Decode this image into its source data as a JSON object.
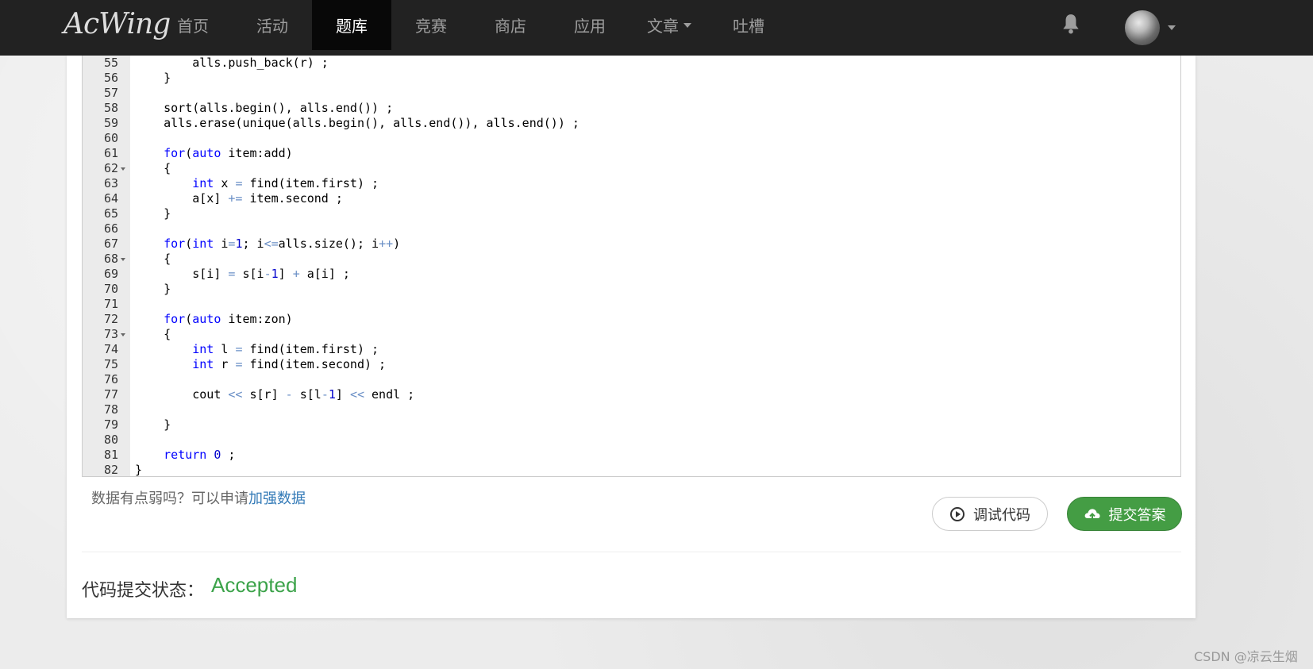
{
  "navbar": {
    "logo": "AcWing",
    "items": [
      {
        "label": "首页"
      },
      {
        "label": "活动"
      },
      {
        "label": "题库",
        "active": true
      },
      {
        "label": "竞赛"
      },
      {
        "label": "商店"
      },
      {
        "label": "应用"
      },
      {
        "label": "文章",
        "dropdown": true
      },
      {
        "label": "吐槽"
      }
    ],
    "bell_icon": "bell-icon",
    "avatar": "user-avatar"
  },
  "editor": {
    "lines": [
      {
        "n": "55",
        "fold": false,
        "code": "        alls.push_back(r) ;"
      },
      {
        "n": "56",
        "fold": false,
        "code": "    }"
      },
      {
        "n": "57",
        "fold": false,
        "code": ""
      },
      {
        "n": "58",
        "fold": false,
        "code": "    sort(alls.begin(), alls.end()) ;"
      },
      {
        "n": "59",
        "fold": false,
        "code": "    alls.erase(unique(alls.begin(), alls.end()), alls.end()) ;"
      },
      {
        "n": "60",
        "fold": false,
        "code": ""
      },
      {
        "n": "61",
        "fold": false,
        "code": "    for(auto item:add)"
      },
      {
        "n": "62",
        "fold": true,
        "code": "    {"
      },
      {
        "n": "63",
        "fold": false,
        "code": "        int x = find(item.first) ;"
      },
      {
        "n": "64",
        "fold": false,
        "code": "        a[x] += item.second ;"
      },
      {
        "n": "65",
        "fold": false,
        "code": "    }"
      },
      {
        "n": "66",
        "fold": false,
        "code": ""
      },
      {
        "n": "67",
        "fold": false,
        "code": "    for(int i=1; i<=alls.size(); i++)"
      },
      {
        "n": "68",
        "fold": true,
        "code": "    {"
      },
      {
        "n": "69",
        "fold": false,
        "code": "        s[i] = s[i-1] + a[i] ;"
      },
      {
        "n": "70",
        "fold": false,
        "code": "    }"
      },
      {
        "n": "71",
        "fold": false,
        "code": ""
      },
      {
        "n": "72",
        "fold": false,
        "code": "    for(auto item:zon)"
      },
      {
        "n": "73",
        "fold": true,
        "code": "    {"
      },
      {
        "n": "74",
        "fold": false,
        "code": "        int l = find(item.first) ;"
      },
      {
        "n": "75",
        "fold": false,
        "code": "        int r = find(item.second) ;"
      },
      {
        "n": "76",
        "fold": false,
        "code": ""
      },
      {
        "n": "77",
        "fold": false,
        "code": "        cout << s[r] - s[l-1] << endl ;"
      },
      {
        "n": "78",
        "fold": false,
        "code": ""
      },
      {
        "n": "79",
        "fold": false,
        "code": "    }"
      },
      {
        "n": "80",
        "fold": false,
        "code": ""
      },
      {
        "n": "81",
        "fold": false,
        "code": "    return 0 ;"
      },
      {
        "n": "82",
        "fold": false,
        "code": "}"
      }
    ]
  },
  "hint": {
    "text": "数据有点弱吗？可以申请",
    "link": "加强数据"
  },
  "buttons": {
    "debug_label": "调试代码",
    "submit_label": "提交答案"
  },
  "status": {
    "label": "代码提交状态：",
    "value": "Accepted",
    "color": "#3ca34a"
  },
  "watermark": "CSDN @凉云生烟"
}
